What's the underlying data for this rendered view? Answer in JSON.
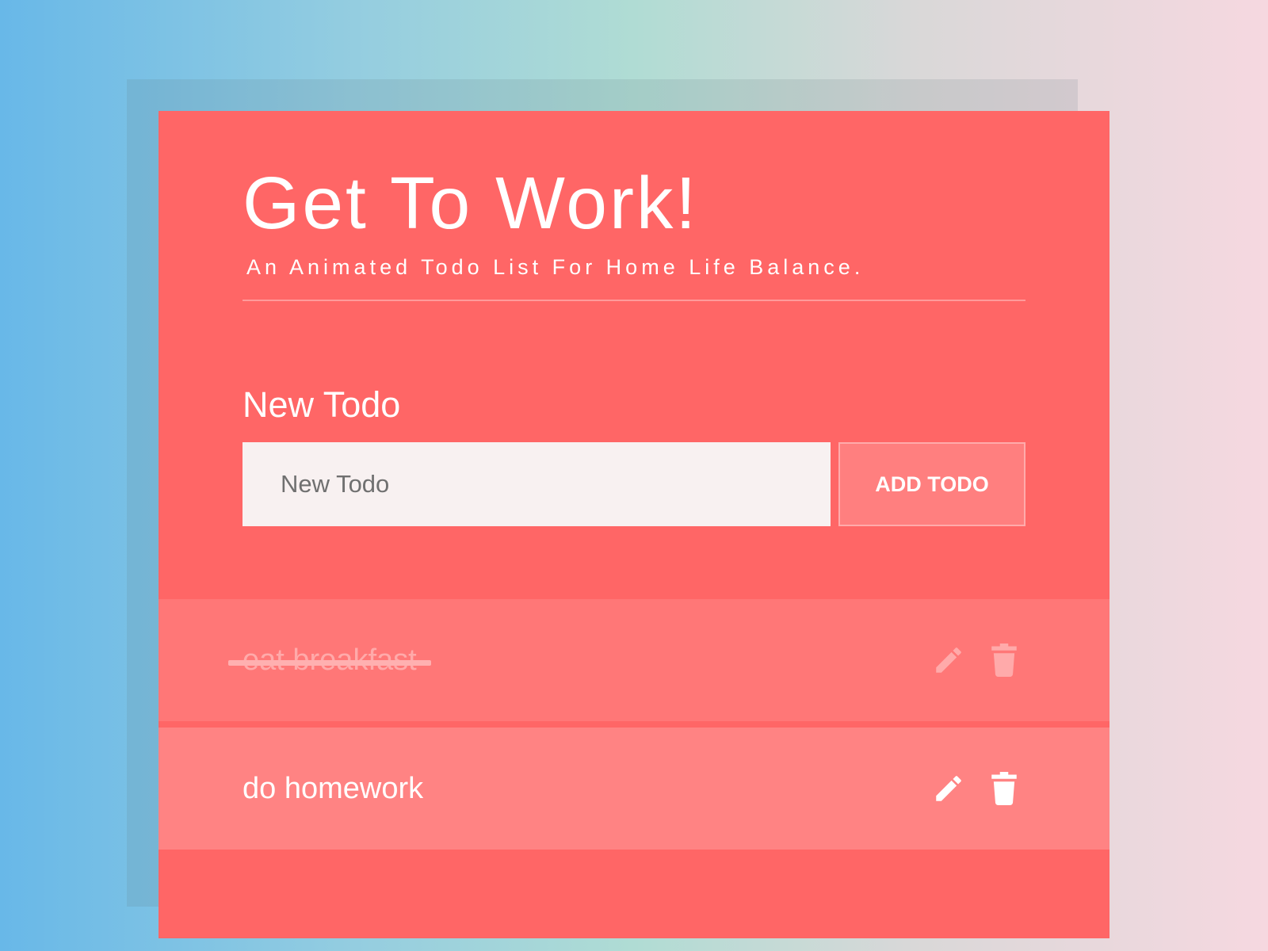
{
  "header": {
    "title": "Get To Work!",
    "subtitle": "An Animated Todo List For Home Life Balance."
  },
  "form": {
    "label": "New Todo",
    "input_value": "",
    "input_placeholder": "New Todo",
    "add_button_label": "ADD TODO"
  },
  "todos": [
    {
      "text": "eat breakfast",
      "completed": true,
      "edit_icon": "pencil-icon",
      "delete_icon": "trash-icon"
    },
    {
      "text": "do homework",
      "completed": false,
      "edit_icon": "pencil-icon",
      "delete_icon": "trash-icon"
    }
  ],
  "colors": {
    "card": "#ff6666",
    "completed_item": "#ff7777",
    "active_item": "#ff8383",
    "input_background": "#f8f1f1",
    "text": "#ffffff"
  }
}
